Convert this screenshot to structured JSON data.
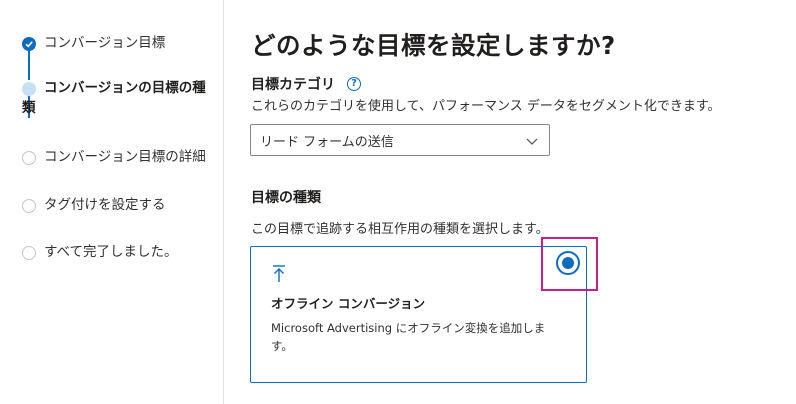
{
  "stepper": {
    "steps": [
      {
        "label": "コンバージョン目標",
        "state": "done"
      },
      {
        "label_line1": "コンバージョンの目標の種",
        "label_line2": "類",
        "state": "current"
      },
      {
        "label": "コンバージョン目標の詳細",
        "state": "todo"
      },
      {
        "label": "タグ付けを設定する",
        "state": "todo"
      },
      {
        "label": "すべて完了しました。",
        "state": "todo"
      }
    ]
  },
  "main": {
    "title": "どのような目標を設定しますか?",
    "category": {
      "label": "目標カテゴリ",
      "help_glyph": "?",
      "description": "これらのカテゴリを使用して、パフォーマンス データをセグメント化できます。",
      "selected_value": "リード フォームの送信"
    },
    "goal_type": {
      "label": "目標の種類",
      "description": "この目標で追跡する相互作用の種類を選択します。",
      "option": {
        "icon": "upload-arrow-icon",
        "title": "オフライン コンバージョン",
        "description": "Microsoft Advertising にオフライン変換を追加します。",
        "selected": true
      }
    }
  },
  "colors": {
    "accent": "#0f6cbd",
    "highlight": "#c0218a",
    "current_step": "#c7e0f4"
  }
}
